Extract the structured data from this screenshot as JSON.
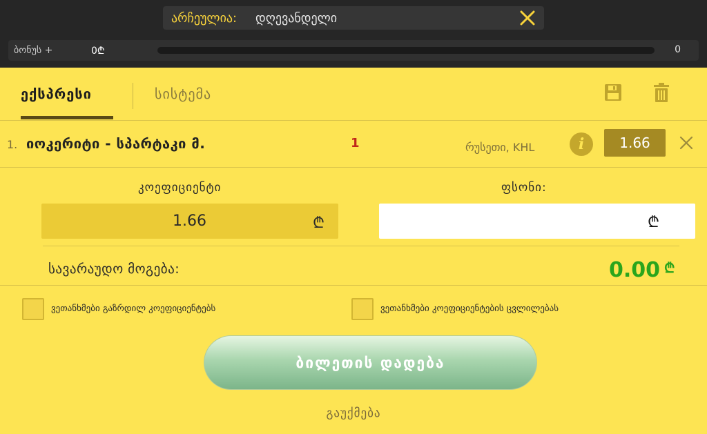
{
  "header": {
    "selected_label": "არჩეულია:",
    "selected_value": "დღევანდელი",
    "close_icon": "close-icon"
  },
  "bonus": {
    "label": "ბონუს +",
    "amount": "0₾",
    "progress": 0,
    "max": "0"
  },
  "tabs": {
    "express": "ექსპრესი",
    "system": "სისტემა",
    "active": "express"
  },
  "actions": {
    "save_icon": "save-icon",
    "trash_icon": "trash-icon"
  },
  "event": {
    "number": "1.",
    "name": "იოკერიტი - სპარტაკი მ.",
    "pick": "1",
    "league": "რუსეთი, KHL",
    "odds": "1.66"
  },
  "bet": {
    "coef_label": "კოეფიციენტი",
    "coef_value": "1.66",
    "currency": "₾",
    "stake_label": "ფსონი:",
    "stake_value": "",
    "payout_label": "სავარაუდო მოგება:",
    "payout_value": "0.00"
  },
  "options": {
    "increase_coef": "ვეთანხმები გაზრდილ კოეფიციენტებს",
    "coef_change": "ვეთანხმები კოეფიციენტების ცვლილებას"
  },
  "buttons": {
    "submit": "ბილეთის დადება",
    "cancel": "გაუქმება"
  },
  "colors": {
    "panel": "#fde453",
    "topbar": "#262626",
    "accent_yellow": "#f7d23b",
    "payout_green": "#2aa51c",
    "pick_red": "#c0271a",
    "odds_badge": "#a58a23"
  }
}
